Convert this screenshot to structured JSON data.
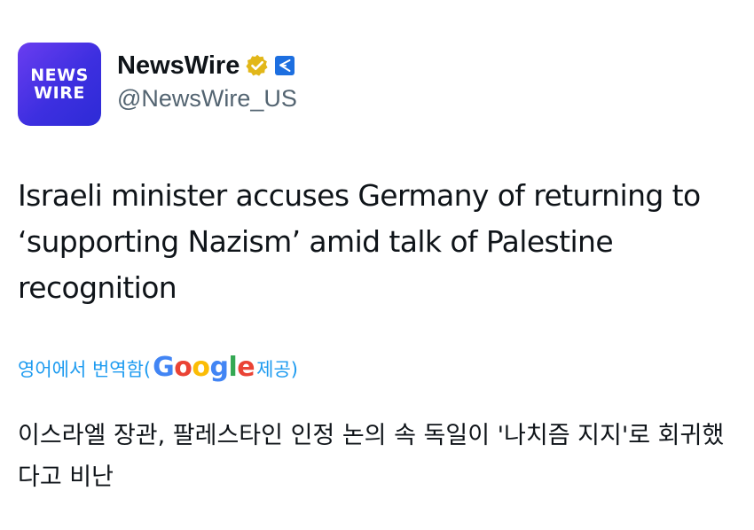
{
  "account": {
    "avatar_line1": "NEWS",
    "avatar_line2": "WIRE",
    "display_name": "NewsWire",
    "handle": "@NewsWire_US",
    "verified_badge_icon": "gold-verified-badge-icon",
    "affiliate_badge_icon": "affiliate-badge-icon"
  },
  "tweet": {
    "text": "Israeli minister accuses Germany of returning to ‘supporting Nazism’ amid talk of Palestine recognition"
  },
  "translation": {
    "prefix": "영어에서 번역함(",
    "provider": "Google",
    "suffix": " 제공)",
    "text": "이스라엘 장관, 팔레스타인 인정 논의 속 독일이 '나치즘 지지'로 회귀했다고 비난"
  },
  "colors": {
    "link": "#1d9bf0",
    "text": "#0f1419",
    "secondary": "#536471",
    "verified_gold": "#e2b719",
    "affiliate_blue": "#1d6fe0",
    "avatar_brand": "#4a34e6"
  }
}
